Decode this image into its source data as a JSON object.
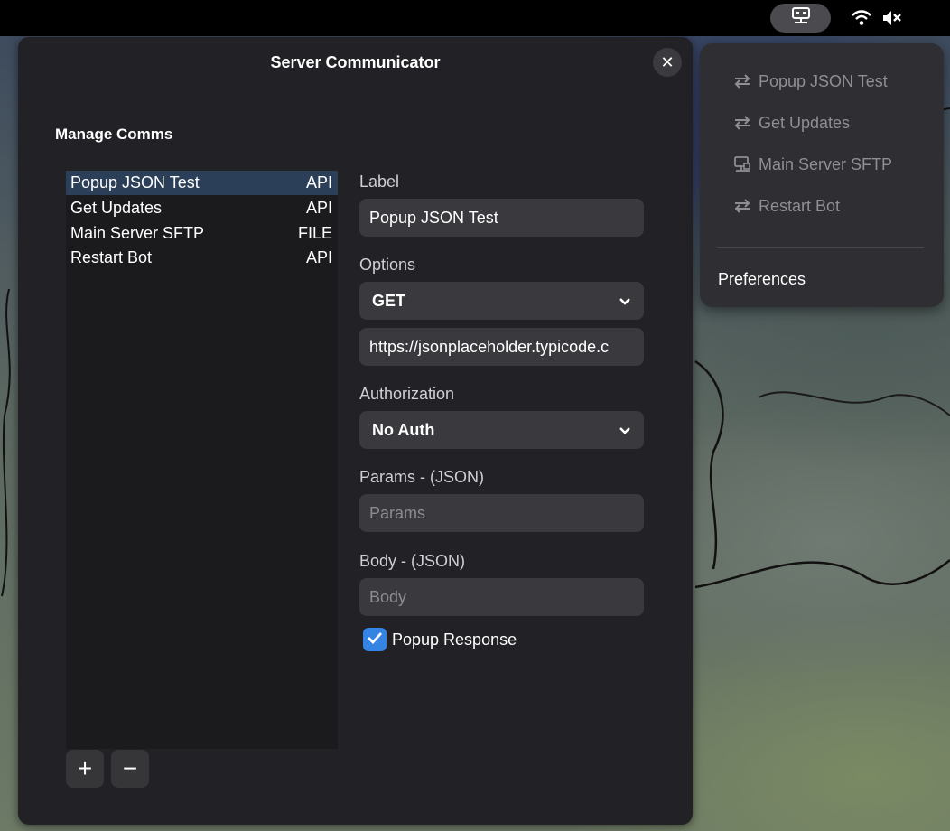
{
  "topbar": {
    "tray_app_icon": "server-communicator-icon",
    "wifi_icon": "wifi-icon",
    "volume_icon": "volume-muted-icon"
  },
  "dialog": {
    "title": "Server Communicator",
    "close_icon": "close-icon",
    "section_title": "Manage Comms",
    "comms": [
      {
        "label": "Popup JSON Test",
        "type": "API",
        "selected": true
      },
      {
        "label": "Get Updates",
        "type": "API",
        "selected": false
      },
      {
        "label": "Main Server SFTP",
        "type": "FILE",
        "selected": false
      },
      {
        "label": "Restart Bot",
        "type": "API",
        "selected": false
      }
    ],
    "add_button": "+",
    "remove_button": "−",
    "form": {
      "label_title": "Label",
      "label_value": "Popup JSON Test",
      "options_title": "Options",
      "method_value": "GET",
      "url_value": "https://jsonplaceholder.typicode.c",
      "auth_title": "Authorization",
      "auth_value": "No Auth",
      "params_title": "Params - (JSON)",
      "params_placeholder": "Params",
      "body_title": "Body - (JSON)",
      "body_placeholder": "Body",
      "popup_response_label": "Popup Response",
      "popup_response_checked": true
    }
  },
  "menu": {
    "items": [
      {
        "label": "Popup JSON Test",
        "icon": "api-arrows-icon"
      },
      {
        "label": "Get Updates",
        "icon": "api-arrows-icon"
      },
      {
        "label": "Main Server SFTP",
        "icon": "network-server-icon"
      },
      {
        "label": "Restart Bot",
        "icon": "api-arrows-icon"
      }
    ],
    "preferences_label": "Preferences"
  },
  "colors": {
    "accent": "#3584e4",
    "selected_row": "#2c3f58",
    "dialog_bg": "#222226",
    "menu_bg": "#2e2e33"
  }
}
